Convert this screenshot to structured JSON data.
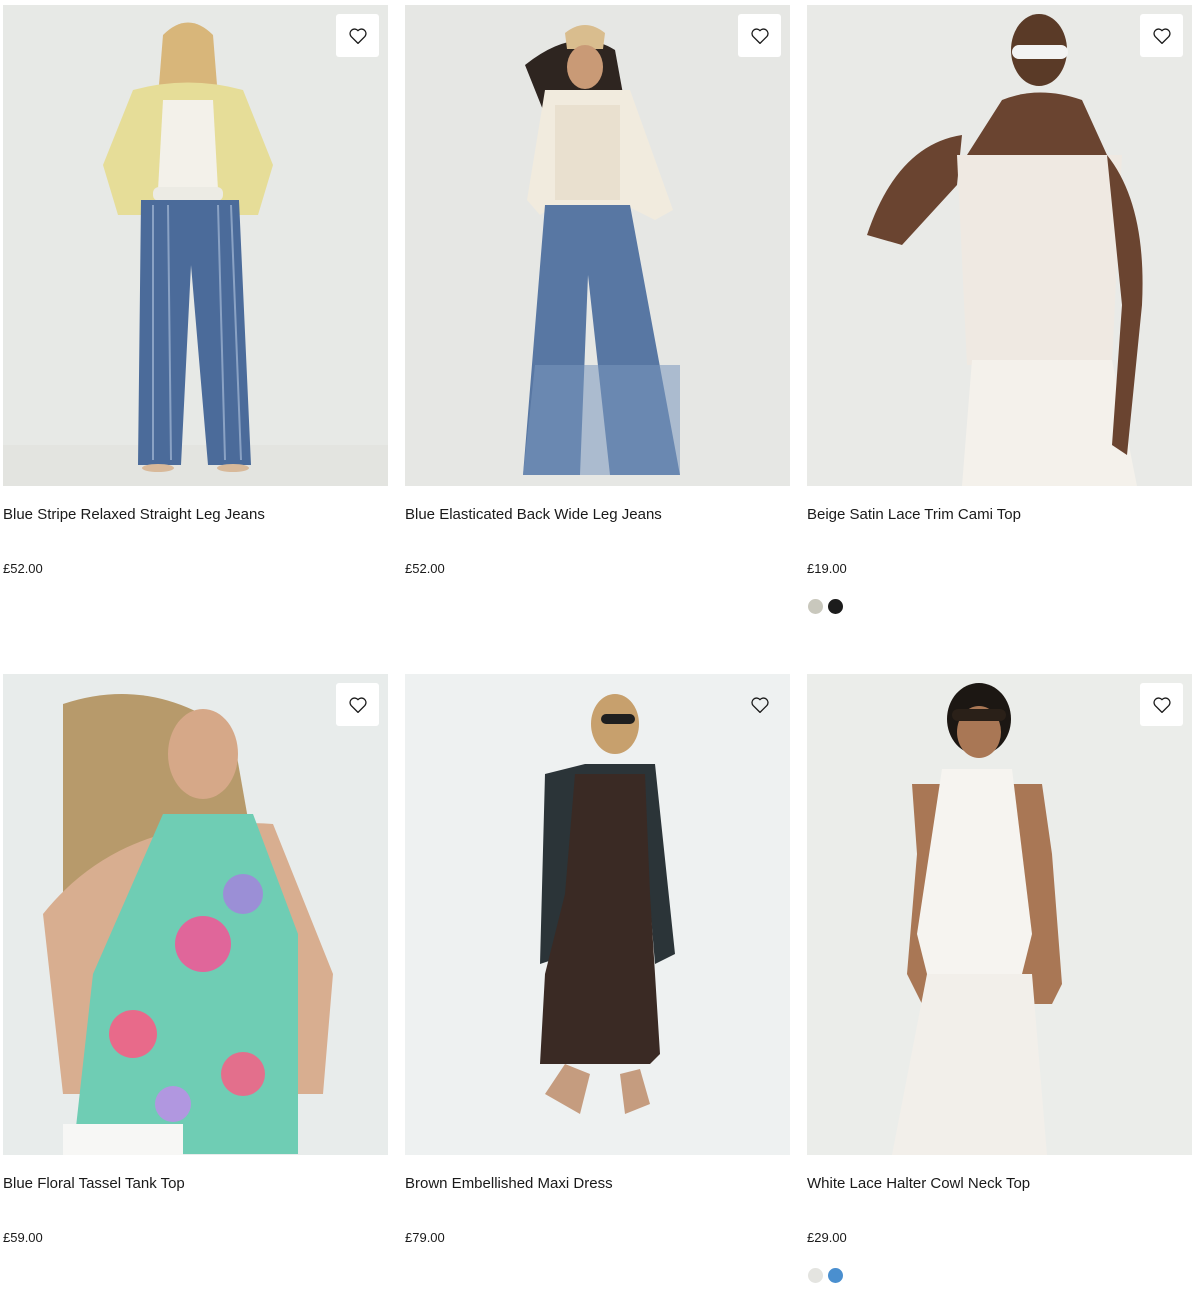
{
  "products": [
    {
      "name": "Blue Stripe Relaxed Straight Leg Jeans",
      "price": "£52.00",
      "image_desc": "model-in-striped-jeans",
      "swatches": []
    },
    {
      "name": "Blue Elasticated Back Wide Leg Jeans",
      "price": "£52.00",
      "image_desc": "model-in-wide-leg-jeans",
      "swatches": []
    },
    {
      "name": "Beige Satin Lace Trim Cami Top",
      "price": "£19.00",
      "image_desc": "model-in-cami-top",
      "swatches": [
        {
          "color": "#c9c8bd",
          "name": "beige"
        },
        {
          "color": "#1c1c1c",
          "name": "black"
        }
      ]
    },
    {
      "name": "Blue Floral Tassel Tank Top",
      "price": "£59.00",
      "image_desc": "model-in-floral-tank",
      "swatches": []
    },
    {
      "name": "Brown Embellished Maxi Dress",
      "price": "£79.00",
      "image_desc": "model-in-maxi-dress",
      "swatches": []
    },
    {
      "name": "White Lace Halter Cowl Neck Top",
      "price": "£29.00",
      "image_desc": "model-in-lace-top",
      "swatches": [
        {
          "color": "#e4e4e0",
          "name": "white"
        },
        {
          "color": "#4a8fcf",
          "name": "blue"
        }
      ]
    }
  ],
  "icons": {
    "wishlist": "heart-outline-icon"
  }
}
